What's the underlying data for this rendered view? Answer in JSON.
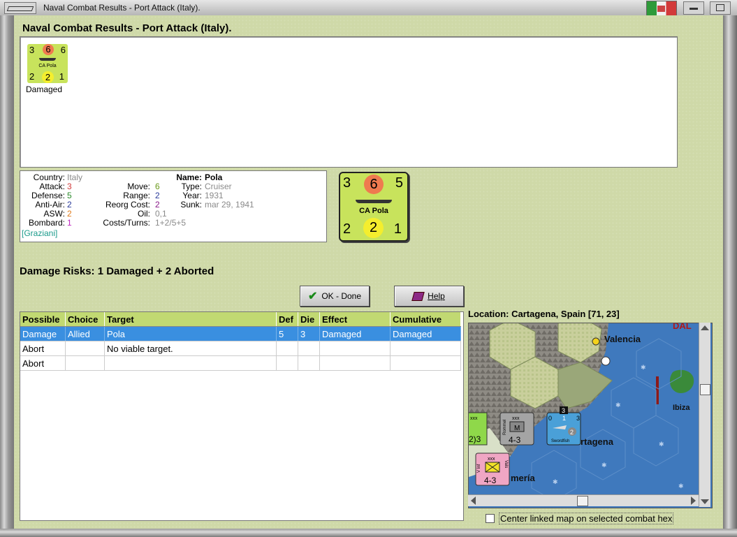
{
  "window": {
    "title": "Naval Combat Results - Port Attack (Italy)."
  },
  "heading": "Naval Combat Results - Port Attack (Italy).",
  "unit_list": [
    {
      "attack": "3",
      "defense_top": "6",
      "move_top": "6",
      "aa": "2",
      "def_bottom": "2",
      "asw": "1",
      "name": "CA Pola",
      "status": "Damaged"
    }
  ],
  "stats": {
    "country_label": "Country:",
    "country": "Italy",
    "attack_label": "Attack:",
    "attack": "3",
    "defense_label": "Defense:",
    "defense": "5",
    "antiair_label": "Anti-Air:",
    "antiair": "2",
    "asw_label": "ASW:",
    "asw": "2",
    "bombard_label": "Bombard:",
    "bombard": "1",
    "leader": "[Graziani]",
    "move_label": "Move:",
    "move": "6",
    "range_label": "Range:",
    "range": "2",
    "reorg_label": "Reorg Cost:",
    "reorg": "2",
    "oil_label": "Oil:",
    "oil": "0,1",
    "costs_label": "Costs/Turns:",
    "costs": "1+2/5+5",
    "name_label": "Name:",
    "name": "Pola",
    "type_label": "Type:",
    "type": "Cruiser",
    "year_label": "Year:",
    "year": "1931",
    "sunk_label": "Sunk:",
    "sunk": "mar 29, 1941"
  },
  "big_counter": {
    "tl": "3",
    "tc": "6",
    "tr": "5",
    "bl": "2",
    "bc": "2",
    "br": "1",
    "name": "CA Pola"
  },
  "damage_risks": "Damage Risks:  1 Damaged + 2 Aborted",
  "buttons": {
    "ok": "OK - Done",
    "help": "Help"
  },
  "table": {
    "headers": [
      "Possible",
      "Choice",
      "Target",
      "Def",
      "Die",
      "Effect",
      "Cumulative"
    ],
    "rows": [
      [
        "Damage",
        "Allied",
        "Pola",
        "5",
        "3",
        "Damaged",
        "Damaged"
      ],
      [
        "Abort",
        "",
        "No viable target.",
        "",
        "",
        "",
        ""
      ],
      [
        "Abort",
        "",
        "",
        "",
        "",
        "",
        ""
      ]
    ],
    "selected_row": 0
  },
  "location": "Location:  Cartagena, Spain [71, 23]",
  "map": {
    "labels": {
      "valencia": "Valencia",
      "ibiza": "Ibiza",
      "cartagena": "rtagena",
      "almeria": "mería",
      "top_clip": "DAL"
    },
    "units": {
      "green": {
        "label": "2)3",
        "size": "xxx"
      },
      "grey": {
        "label": "4-3",
        "size": "xxx",
        "side": "Rommel",
        "symbol": "M"
      },
      "blue": {
        "name": "Swordfish",
        "n1": "0",
        "n2": "1",
        "n3": "3",
        "n4": "2",
        "stack": "3"
      },
      "pink": {
        "label": "4-3",
        "size": "xxx",
        "side": "Vals",
        "side2": "V Inf"
      }
    }
  },
  "center_checkbox": {
    "label": "Center linked map on selected combat hex",
    "checked": false
  }
}
